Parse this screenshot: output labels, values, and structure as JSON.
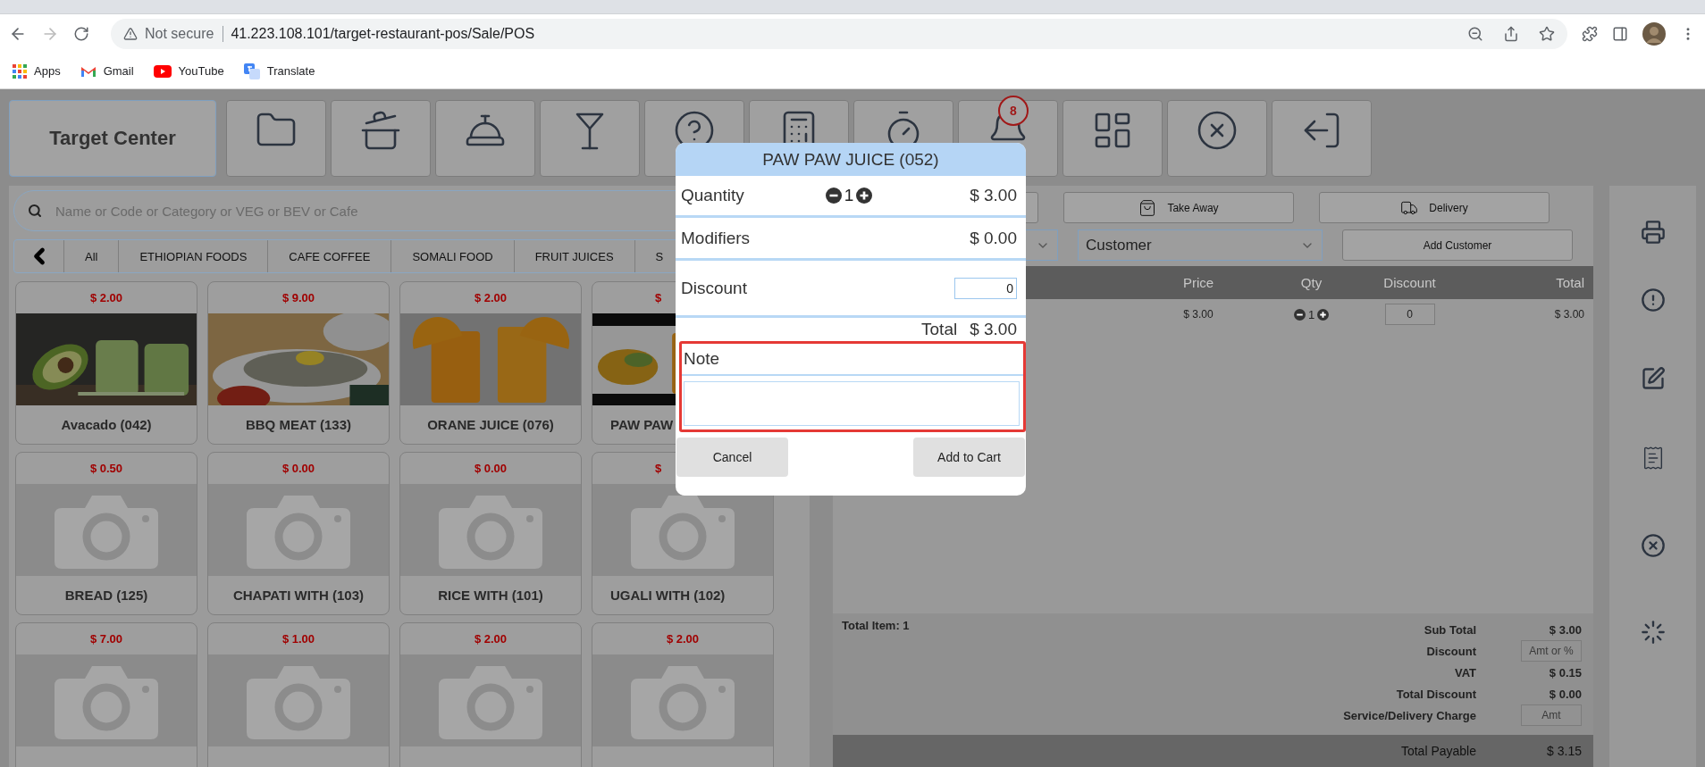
{
  "browser": {
    "security": "Not secure",
    "url": "41.223.108.101/target-restaurant-pos/Sale/POS",
    "bookmarks": [
      {
        "label": "Apps",
        "kind": "apps"
      },
      {
        "label": "Gmail",
        "kind": "mail"
      },
      {
        "label": "YouTube",
        "kind": "video"
      },
      {
        "label": "Translate",
        "kind": "translate"
      }
    ]
  },
  "toolbar": {
    "store": "Target Center",
    "badge": "8"
  },
  "search": {
    "placeholder": "Name or Code or Category or VEG or BEV or Cafe"
  },
  "categories": [
    "All",
    "ETHIOPIAN FOODS",
    "CAFE COFFEE",
    "SOMALI FOOD",
    "FRUIT JUICES",
    "S"
  ],
  "products": [
    {
      "price": "$ 2.00",
      "name": "Avacado (042)",
      "kind": "picture",
      "clipped": false
    },
    {
      "price": "$ 9.00",
      "name": "BBQ MEAT (133)",
      "kind": "picture",
      "clipped": false
    },
    {
      "price": "$ 2.00",
      "name": "ORANE JUICE (076)",
      "kind": "picture",
      "clipped": false
    },
    {
      "price": "$",
      "name": "PAW PAW",
      "kind": "picture",
      "clipped": true
    },
    {
      "price": "$ 0.50",
      "name": "BREAD (125)",
      "kind": "no-image",
      "clipped": false
    },
    {
      "price": "$ 0.00",
      "name": "CHAPATI WITH (103)",
      "kind": "no-image",
      "clipped": false
    },
    {
      "price": "$ 0.00",
      "name": "RICE WITH (101)",
      "kind": "no-image",
      "clipped": false
    },
    {
      "price": "$",
      "name": "UGALI WITH (102)",
      "kind": "no-image",
      "clipped": true
    },
    {
      "price": "$ 7.00",
      "kind": "no-image",
      "clipped": false
    },
    {
      "price": "$ 1.00",
      "kind": "no-image",
      "clipped": false
    },
    {
      "price": "$ 2.00",
      "kind": "no-image",
      "clipped": false
    },
    {
      "price": "$ 2.00",
      "kind": "no-image",
      "clipped": false
    }
  ],
  "cart": {
    "order_types": [
      {
        "label": "Take Away",
        "kind": "bag"
      },
      {
        "label": "Delivery",
        "kind": "truck"
      }
    ],
    "customer": {
      "value": "Customer"
    },
    "add_customer": "Add Customer",
    "columns": [
      "Price",
      "Qty",
      "Discount",
      "Total"
    ],
    "rows": [
      {
        "price": "$ 3.00",
        "qty": "1",
        "discount": "0",
        "total": "$ 3.00"
      }
    ],
    "total_items": "Total Item: 1",
    "summary": [
      {
        "label": "Sub Total",
        "value": "$ 3.00",
        "kind": "text"
      },
      {
        "label": "Discount",
        "placeholder": "Amt or %",
        "kind": "input"
      },
      {
        "label": "VAT",
        "value": "$ 0.15",
        "kind": "text"
      },
      {
        "label": "Total Discount",
        "value": "$ 0.00",
        "kind": "text"
      },
      {
        "label": "Service/Delivery Charge",
        "placeholder": "Amt",
        "kind": "input"
      }
    ],
    "total_payable": {
      "label": "Total Payable",
      "value": "$ 3.15"
    }
  },
  "dialog": {
    "title": "PAW PAW JUICE (052)",
    "quantity": {
      "label": "Quantity",
      "value": "1",
      "price": "$ 3.00"
    },
    "modifiers": {
      "label": "Modifiers",
      "price": "$ 0.00"
    },
    "discount": {
      "label": "Discount",
      "value": "0"
    },
    "total": {
      "label": "Total",
      "value": "$ 3.00"
    },
    "note": {
      "label": "Note"
    },
    "cancel": "Cancel",
    "confirm": "Add to Cart"
  }
}
